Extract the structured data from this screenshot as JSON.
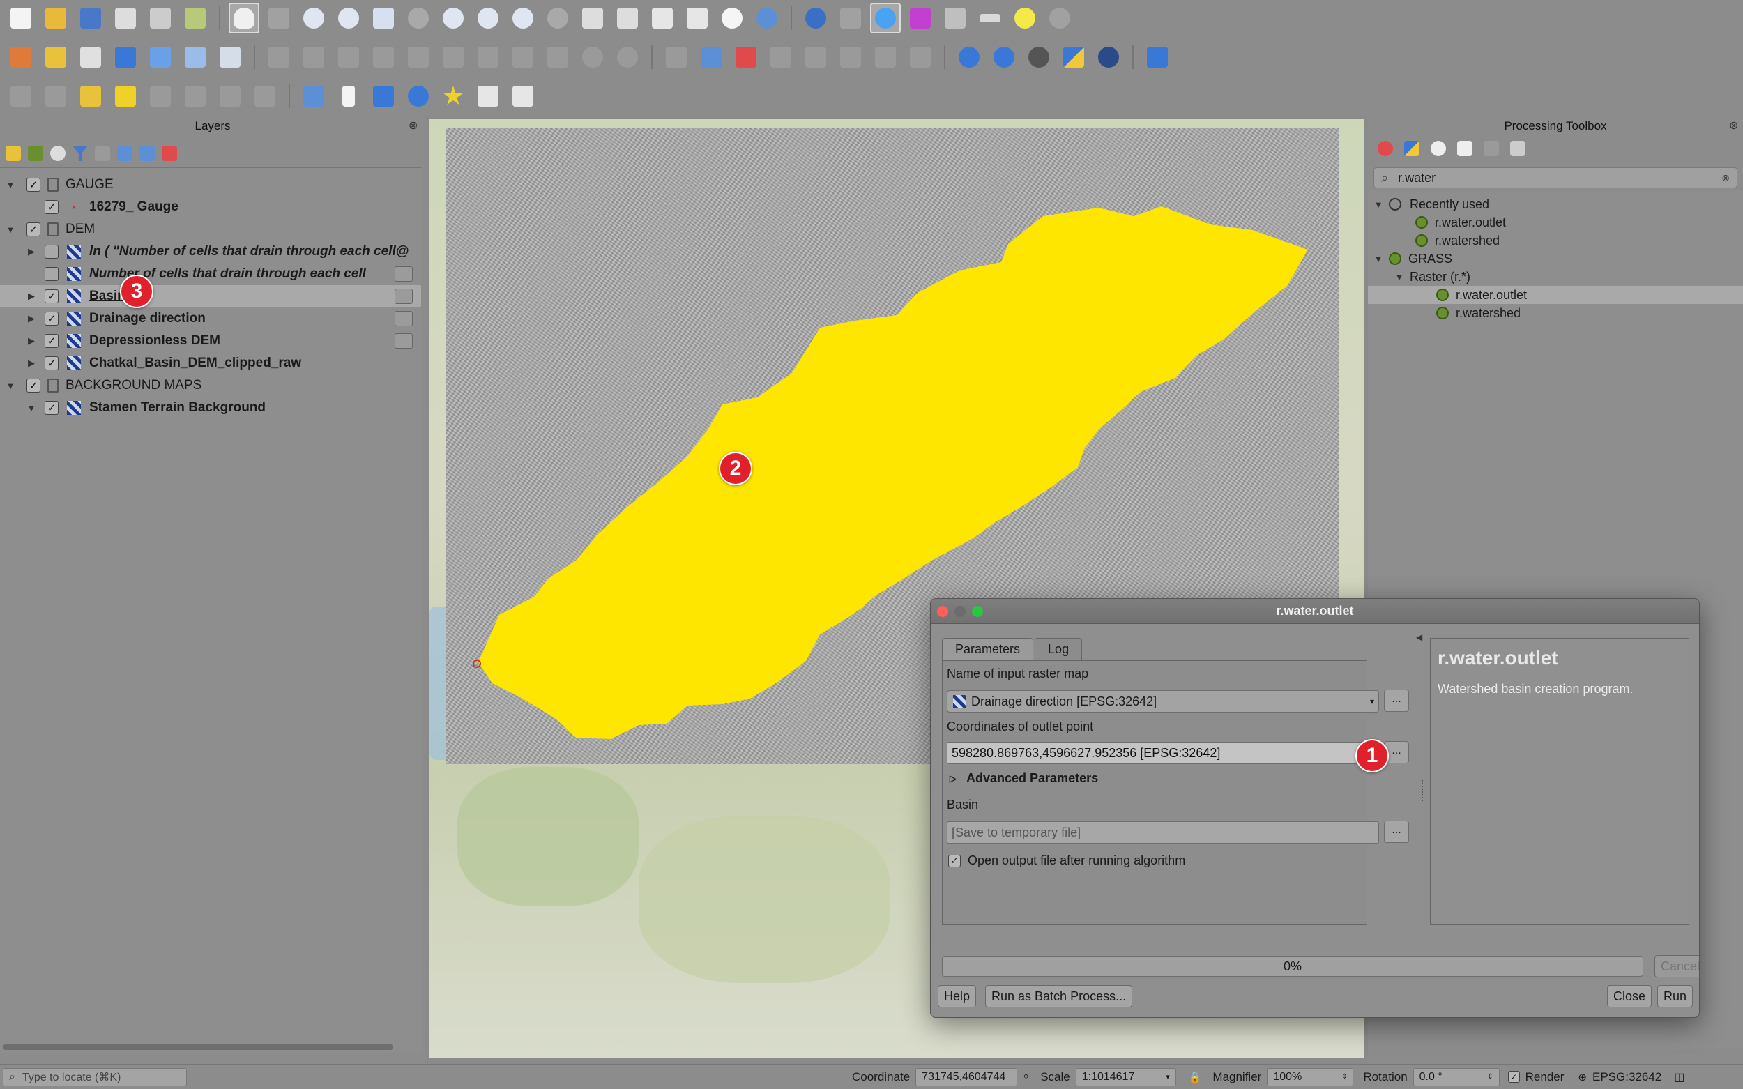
{
  "layers_panel": {
    "title": "Layers",
    "rows": [
      {
        "label": "GAUGE",
        "kind": "group"
      },
      {
        "label": "16279_ Gauge",
        "kind": "point"
      },
      {
        "label": "DEM",
        "kind": "group"
      },
      {
        "label": "ln ( \"Number of cells that drain through each cell@",
        "kind": "raster"
      },
      {
        "label": "Number of cells that drain through each cell",
        "kind": "raster"
      },
      {
        "label": "Basin",
        "kind": "raster"
      },
      {
        "label": "Drainage direction",
        "kind": "raster"
      },
      {
        "label": "Depressionless DEM",
        "kind": "raster"
      },
      {
        "label": "Chatkal_Basin_DEM_clipped_raw",
        "kind": "raster"
      },
      {
        "label": "BACKGROUND MAPS",
        "kind": "group"
      },
      {
        "label": "Stamen Terrain Background",
        "kind": "raster"
      }
    ]
  },
  "processing": {
    "title": "Processing Toolbox",
    "search_value": "r.water",
    "tree": {
      "recent_label": "Recently used",
      "recent_items": [
        "r.water.outlet",
        "r.watershed"
      ],
      "grass_label": "GRASS",
      "raster_label": "Raster (r.*)",
      "raster_items": [
        "r.water.outlet",
        "r.watershed"
      ]
    }
  },
  "dialog": {
    "title": "r.water.outlet",
    "tabs": [
      "Parameters",
      "Log"
    ],
    "input_label": "Name of input raster map",
    "input_value": "Drainage direction [EPSG:32642]",
    "coord_label": "Coordinates of outlet point",
    "coord_value": "598280.869763,4596627.952356 [EPSG:32642]",
    "advanced_label": "Advanced Parameters",
    "basin_label": "Basin",
    "basin_placeholder": "[Save to temporary file]",
    "open_output_label": "Open output file after running algorithm",
    "help_title": "r.water.outlet",
    "help_text": "Watershed basin creation program.",
    "progress_text": "0%",
    "cancel_label": "Cancel",
    "help_btn": "Help",
    "batch_btn": "Run as Batch Process...",
    "close_btn": "Close",
    "run_btn": "Run",
    "dots": "...",
    "progress_value": 0
  },
  "statusbar": {
    "locate_placeholder": "Type to locate (⌘K)",
    "coordinate_label": "Coordinate",
    "coordinate_value": "731745,4604744",
    "scale_label": "Scale",
    "scale_value": "1:1014617",
    "magnifier_label": "Magnifier",
    "magnifier_value": "100%",
    "rotation_label": "Rotation",
    "rotation_value": "0.0 °",
    "render_label": "Render",
    "crs_label": "EPSG:32642"
  },
  "badges": [
    "1",
    "2",
    "3"
  ],
  "colors": {
    "basin": "#ffe600",
    "badge": "#e0202a",
    "gauge_point": "#c0392b"
  }
}
